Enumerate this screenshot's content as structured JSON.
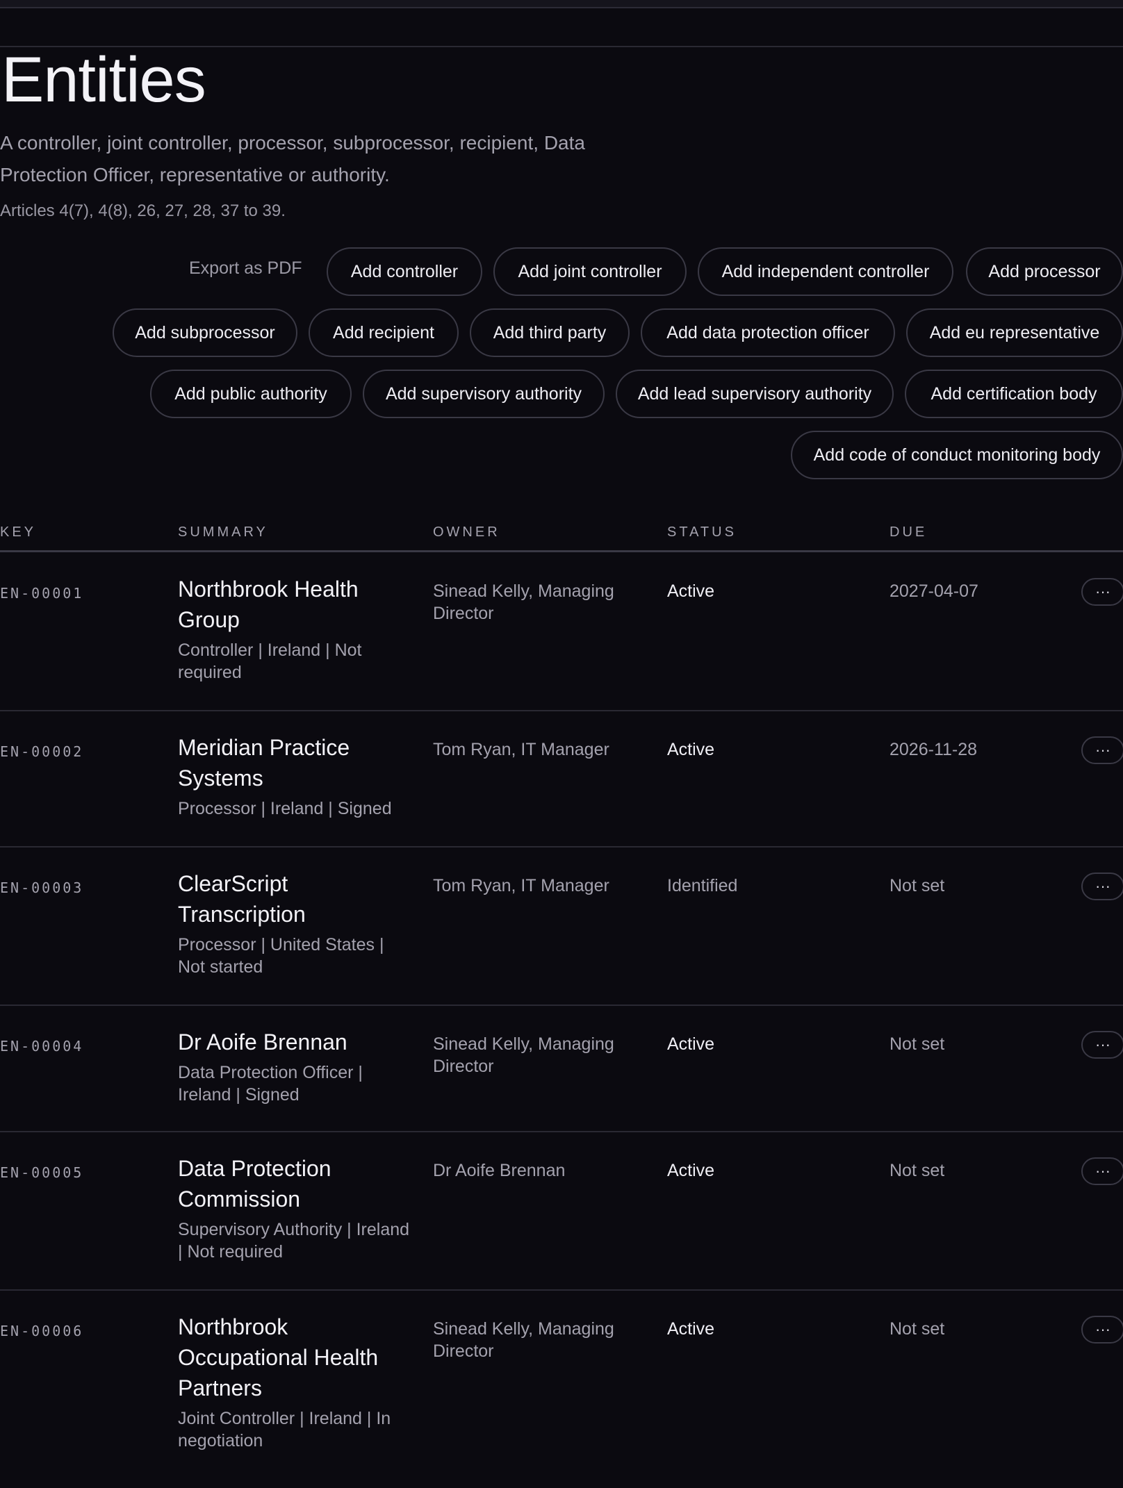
{
  "page": {
    "title": "Entities",
    "description": "A controller, joint controller, processor, subprocessor, recipient, Data Protection Officer, representative or authority.",
    "articles": "Articles 4(7), 4(8), 26, 27, 28, 37 to 39."
  },
  "actions": {
    "export": "Export as PDF",
    "add_controller": "Add controller",
    "add_joint_controller": "Add joint controller",
    "add_independent_controller": "Add independent controller",
    "add_processor": "Add processor",
    "add_subprocessor": "Add subprocessor",
    "add_recipient": "Add recipient",
    "add_third_party": "Add third party",
    "add_dpo": "Add data protection officer",
    "add_eu_representative": "Add eu representative",
    "add_public_authority": "Add public authority",
    "add_supervisory_authority": "Add supervisory authority",
    "add_lead_supervisory_authority": "Add lead supervisory authority",
    "add_certification_body": "Add certification body",
    "add_code_of_conduct_body": "Add code of conduct monitoring body"
  },
  "table": {
    "headers": {
      "key": "KEY",
      "summary": "SUMMARY",
      "owner": "OWNER",
      "status": "STATUS",
      "due": "DUE"
    },
    "more_icon": "ellipsis-icon",
    "more_label": "···",
    "rows": [
      {
        "key": "EN-00001",
        "title": "Northbrook Health Group",
        "meta": "Controller | Ireland | Not required",
        "owner": "Sinead Kelly, Managing Director",
        "status": "Active",
        "due": "2027-04-07"
      },
      {
        "key": "EN-00002",
        "title": "Meridian Practice Systems",
        "meta": "Processor | Ireland | Signed",
        "owner": "Tom Ryan, IT Manager",
        "status": "Active",
        "due": "2026-11-28"
      },
      {
        "key": "EN-00003",
        "title": "ClearScript Transcription",
        "meta": "Processor | United States | Not started",
        "owner": "Tom Ryan, IT Manager",
        "status": "Identified",
        "due": "Not set"
      },
      {
        "key": "EN-00004",
        "title": "Dr Aoife Brennan",
        "meta": "Data Protection Officer | Ireland | Signed",
        "owner": "Sinead Kelly, Managing Director",
        "status": "Active",
        "due": "Not set"
      },
      {
        "key": "EN-00005",
        "title": "Data Protection Commission",
        "meta": "Supervisory Authority | Ireland | Not required",
        "owner": "Dr Aoife Brennan",
        "status": "Active",
        "due": "Not set"
      },
      {
        "key": "EN-00006",
        "title": "Northbrook Occupational Health Partners",
        "meta": "Joint Controller | Ireland | In negotiation",
        "owner": "Sinead Kelly, Managing Director",
        "status": "Active",
        "due": "Not set"
      }
    ]
  }
}
